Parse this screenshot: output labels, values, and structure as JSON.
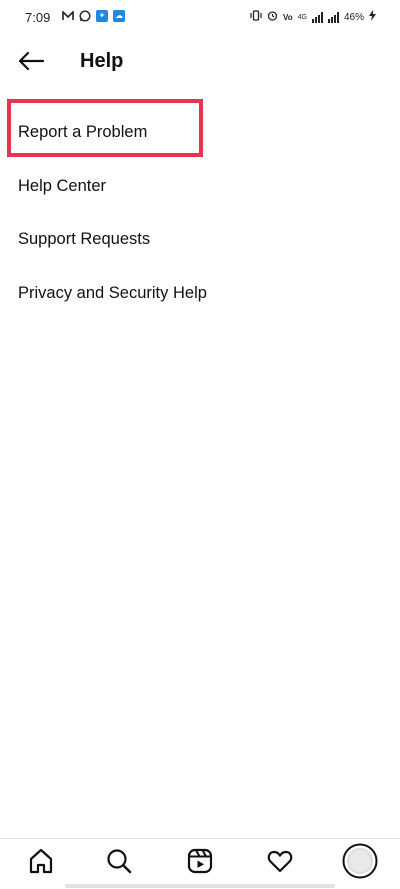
{
  "status_bar": {
    "time": "7:09",
    "battery": "46%",
    "network_label": "4G",
    "left_icons": [
      "mail-icon",
      "whatsapp-icon",
      "messenger-icon",
      "cloud-icon"
    ],
    "right_icons": [
      "vibrate-icon",
      "alarm-icon",
      "volte-icon",
      "signal-icon",
      "signal-icon",
      "charging-icon"
    ]
  },
  "header": {
    "title": "Help",
    "back_icon": "back-arrow-icon"
  },
  "menu": {
    "items": [
      {
        "label": "Report a Problem",
        "highlighted": true
      },
      {
        "label": "Help Center"
      },
      {
        "label": "Support Requests"
      },
      {
        "label": "Privacy and Security Help"
      }
    ]
  },
  "bottom_nav": {
    "items": [
      "home-icon",
      "search-icon",
      "reels-icon",
      "heart-icon",
      "profile-avatar"
    ]
  },
  "colors": {
    "highlight": "#e8344e",
    "text": "#111111",
    "background": "#ffffff"
  }
}
